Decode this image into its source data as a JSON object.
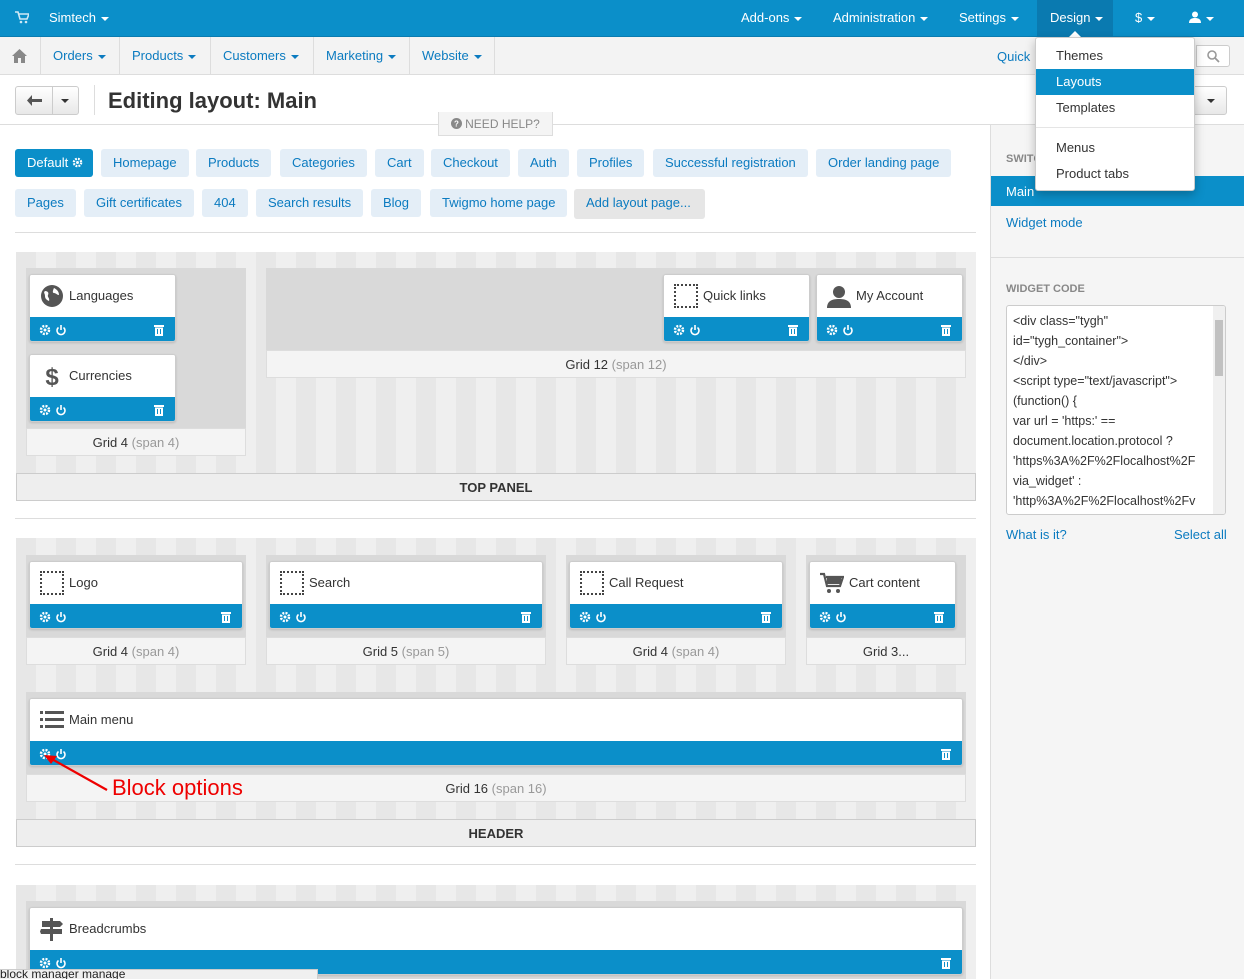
{
  "topbar": {
    "brand": "Simtech",
    "nav": [
      "Add-ons",
      "Administration",
      "Settings",
      "Design",
      "$"
    ],
    "colors": {
      "primary": "#0b8fc9"
    }
  },
  "menubar": {
    "items": [
      "Orders",
      "Products",
      "Customers",
      "Marketing",
      "Website"
    ],
    "quick": "Quick"
  },
  "toolbar": {
    "title": "Editing layout: Main",
    "help": "NEED HELP?"
  },
  "design_menu": {
    "items": [
      "Themes",
      "Layouts",
      "Templates",
      "Menus",
      "Product tabs"
    ],
    "selected": "Layouts"
  },
  "tabs": {
    "row1": [
      "Default",
      "Homepage",
      "Products",
      "Categories",
      "Cart",
      "Checkout",
      "Auth",
      "Profiles",
      "Successful registration",
      "Order landing page"
    ],
    "row2": [
      "Pages",
      "Gift certificates",
      "404",
      "Search results",
      "Blog",
      "Twigmo home page",
      "Add layout page..."
    ]
  },
  "top_panel": {
    "title": "TOP PANEL",
    "grids": [
      {
        "name": "Grid 4",
        "span": "(span 4)"
      },
      {
        "name": "Grid 12",
        "span": "(span 12)"
      }
    ],
    "blocks": [
      "Languages",
      "Currencies",
      "Quick links",
      "My Account"
    ]
  },
  "header": {
    "title": "HEADER",
    "grids": [
      {
        "name": "Grid 4",
        "span": "(span 4)"
      },
      {
        "name": "Grid 5",
        "span": "(span 5)"
      },
      {
        "name": "Grid 4",
        "span": "(span 4)"
      },
      {
        "name": "Grid 3...",
        "span": ""
      },
      {
        "name": "Grid 16",
        "span": "(span 16)"
      }
    ],
    "blocks": [
      "Logo",
      "Search",
      "Call Request",
      "Cart content",
      "Main menu"
    ]
  },
  "content": {
    "blocks": [
      "Breadcrumbs"
    ]
  },
  "annotation": "Block options",
  "sidebar": {
    "switch_label": "SWITC",
    "items": [
      "Main",
      "Widget mode"
    ],
    "widget_code_label": "WIDGET CODE",
    "widget_code": "<div class=\"tygh\"\nid=\"tygh_container\">\n</div>\n<script type=\"text/javascript\">\n(function() {\nvar url = 'https:' ==\ndocument.location.protocol ?\n'https%3A%2F%2Flocalhost%2F\nvia_widget' :\n'http%3A%2F%2Flocalhost%2Fv",
    "what_is_it": "What is it?",
    "select_all": "Select all"
  },
  "statusbar": "block manager manage"
}
